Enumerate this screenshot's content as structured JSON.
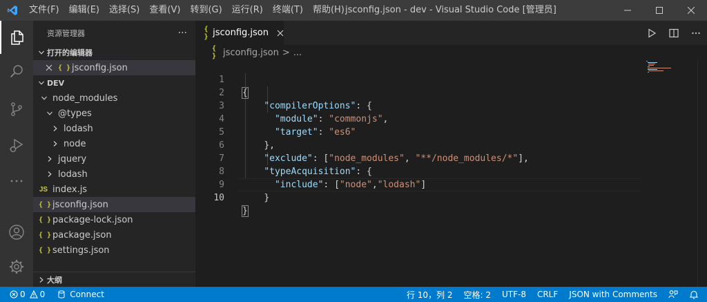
{
  "window": {
    "title": "jsconfig.json - dev - Visual Studio Code [管理员]",
    "menu": [
      "文件(F)",
      "编辑(E)",
      "选择(S)",
      "查看(V)",
      "转到(G)",
      "运行(R)",
      "终端(T)",
      "帮助(H)"
    ]
  },
  "activity_bar": {
    "items": [
      "explorer-icon",
      "search-icon",
      "source-control-icon",
      "run-debug-icon",
      "more-icon"
    ],
    "bottom": [
      "account-icon",
      "settings-gear-icon"
    ]
  },
  "sidebar": {
    "title": "资源管理器",
    "more_label": "···",
    "open_editors_label": "打开的编辑器",
    "open_editors": [
      {
        "icon": "{ }",
        "name": "jsconfig.json"
      }
    ],
    "workspace_label": "DEV",
    "tree": [
      {
        "name": "node_modules",
        "icon": "chevron-down",
        "depth": 1
      },
      {
        "name": "@types",
        "icon": "chevron-down",
        "depth": 2
      },
      {
        "name": "lodash",
        "icon": "chevron-right",
        "depth": 3
      },
      {
        "name": "node",
        "icon": "chevron-right",
        "depth": 3
      },
      {
        "name": "jquery",
        "icon": "chevron-right",
        "depth": 2
      },
      {
        "name": "lodash",
        "icon": "chevron-right",
        "depth": 2
      },
      {
        "name": "index.js",
        "icon": "JS",
        "depth": 1
      },
      {
        "name": "jsconfig.json",
        "icon": "{ }",
        "depth": 1
      },
      {
        "name": "package-lock.json",
        "icon": "{ }",
        "depth": 1
      },
      {
        "name": "package.json",
        "icon": "{ }",
        "depth": 1
      },
      {
        "name": "settings.json",
        "icon": "{ }",
        "depth": 1
      }
    ],
    "outline_label": "大纲"
  },
  "editor": {
    "tab": {
      "icon": "{ }",
      "label": "jsconfig.json"
    },
    "breadcrumb": {
      "icon": "{ }",
      "file": "jsconfig.json",
      "sep": ">",
      "rest": "..."
    },
    "line_numbers": [
      "1",
      "2",
      "3",
      "4",
      "5",
      "6",
      "7",
      "8",
      "9",
      "10"
    ],
    "current_line": 10
  },
  "status_bar": {
    "errors": "0",
    "warnings": "0",
    "connect": "Connect",
    "position": "行 10，列 2",
    "spaces": "空格: 2",
    "encoding": "UTF-8",
    "eol": "CRLF",
    "language": "JSON with Comments"
  },
  "colors": {
    "accent": "#007acc",
    "key": "#9cdcfe",
    "string": "#ce9178",
    "json_icon": "#cbcb41"
  }
}
